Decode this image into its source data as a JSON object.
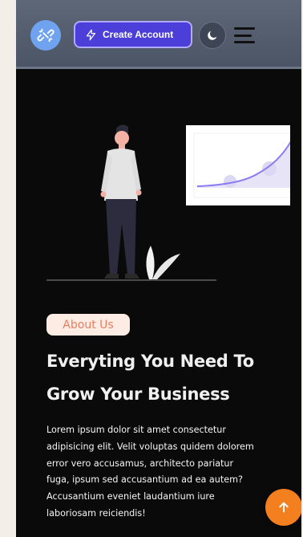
{
  "header": {
    "logo_icon": "link-broken-icon",
    "create_account_label": "Create Account",
    "create_account_icon": "lightning-icon",
    "theme_toggle_icon": "moon-icon",
    "menu_icon": "hamburger-menu-icon"
  },
  "about": {
    "badge": "About Us",
    "headline_lines": [
      "Everyting You Need To",
      "Grow Your Business"
    ],
    "paragraph_lines": [
      "Lorem ipsum dolor sit amet consectetur",
      "adipisicing elit. Velit voluptas quidem dolorem",
      "error vero accusamus, architecto pariatur",
      "fuga, ipsum sed accusantium ad ea autem?",
      "Accusantium eveniet laudantium iure",
      "laboriosam reiciendis!"
    ]
  },
  "scroll_top_icon": "arrow-up-icon",
  "colors": {
    "accent": "#4b3ed9",
    "badge_bg": "#fdece3",
    "badge_text": "#ea7d5f",
    "scroll_button": "#f47f1f",
    "chart_line": "#8b7cf0",
    "logo_bg": "#6fa3f0"
  }
}
